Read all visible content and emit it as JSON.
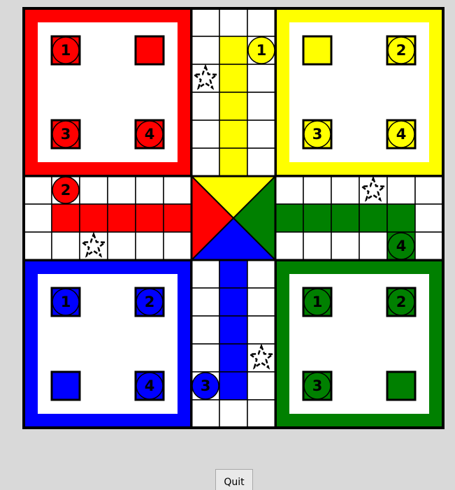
{
  "colors": {
    "background": "#d9d9d9",
    "red": "#ff0000",
    "yellow": "#ffff00",
    "green": "#008000",
    "blue": "#0000ff",
    "white": "#ffffff",
    "black": "#000000"
  },
  "players": [
    {
      "color": "red",
      "corner": "top-left"
    },
    {
      "color": "yellow",
      "corner": "top-right"
    },
    {
      "color": "blue",
      "corner": "bottom-left"
    },
    {
      "color": "green",
      "corner": "bottom-right"
    }
  ],
  "home_slots": [
    {
      "color": "red",
      "pieces": [
        "1",
        null,
        "3",
        "4"
      ]
    },
    {
      "color": "yellow",
      "pieces": [
        null,
        "2",
        "3",
        "4"
      ]
    },
    {
      "color": "blue",
      "pieces": [
        "1",
        "2",
        null,
        "4"
      ]
    },
    {
      "color": "green",
      "pieces": [
        "1",
        "2",
        "3",
        null
      ]
    }
  ],
  "track_pieces": [
    {
      "color": "yellow",
      "label": "1",
      "square": "top arm, 2nd row, right column"
    },
    {
      "color": "red",
      "label": "2",
      "square": "left arm, top row, 2nd column"
    },
    {
      "color": "green",
      "label": "4",
      "square": "right arm, bottom row, 5th column"
    },
    {
      "color": "blue",
      "label": "3",
      "square": "bottom arm, 5th row, left column"
    }
  ],
  "safe_stars": 4,
  "quit_button": {
    "label": "Quit"
  }
}
